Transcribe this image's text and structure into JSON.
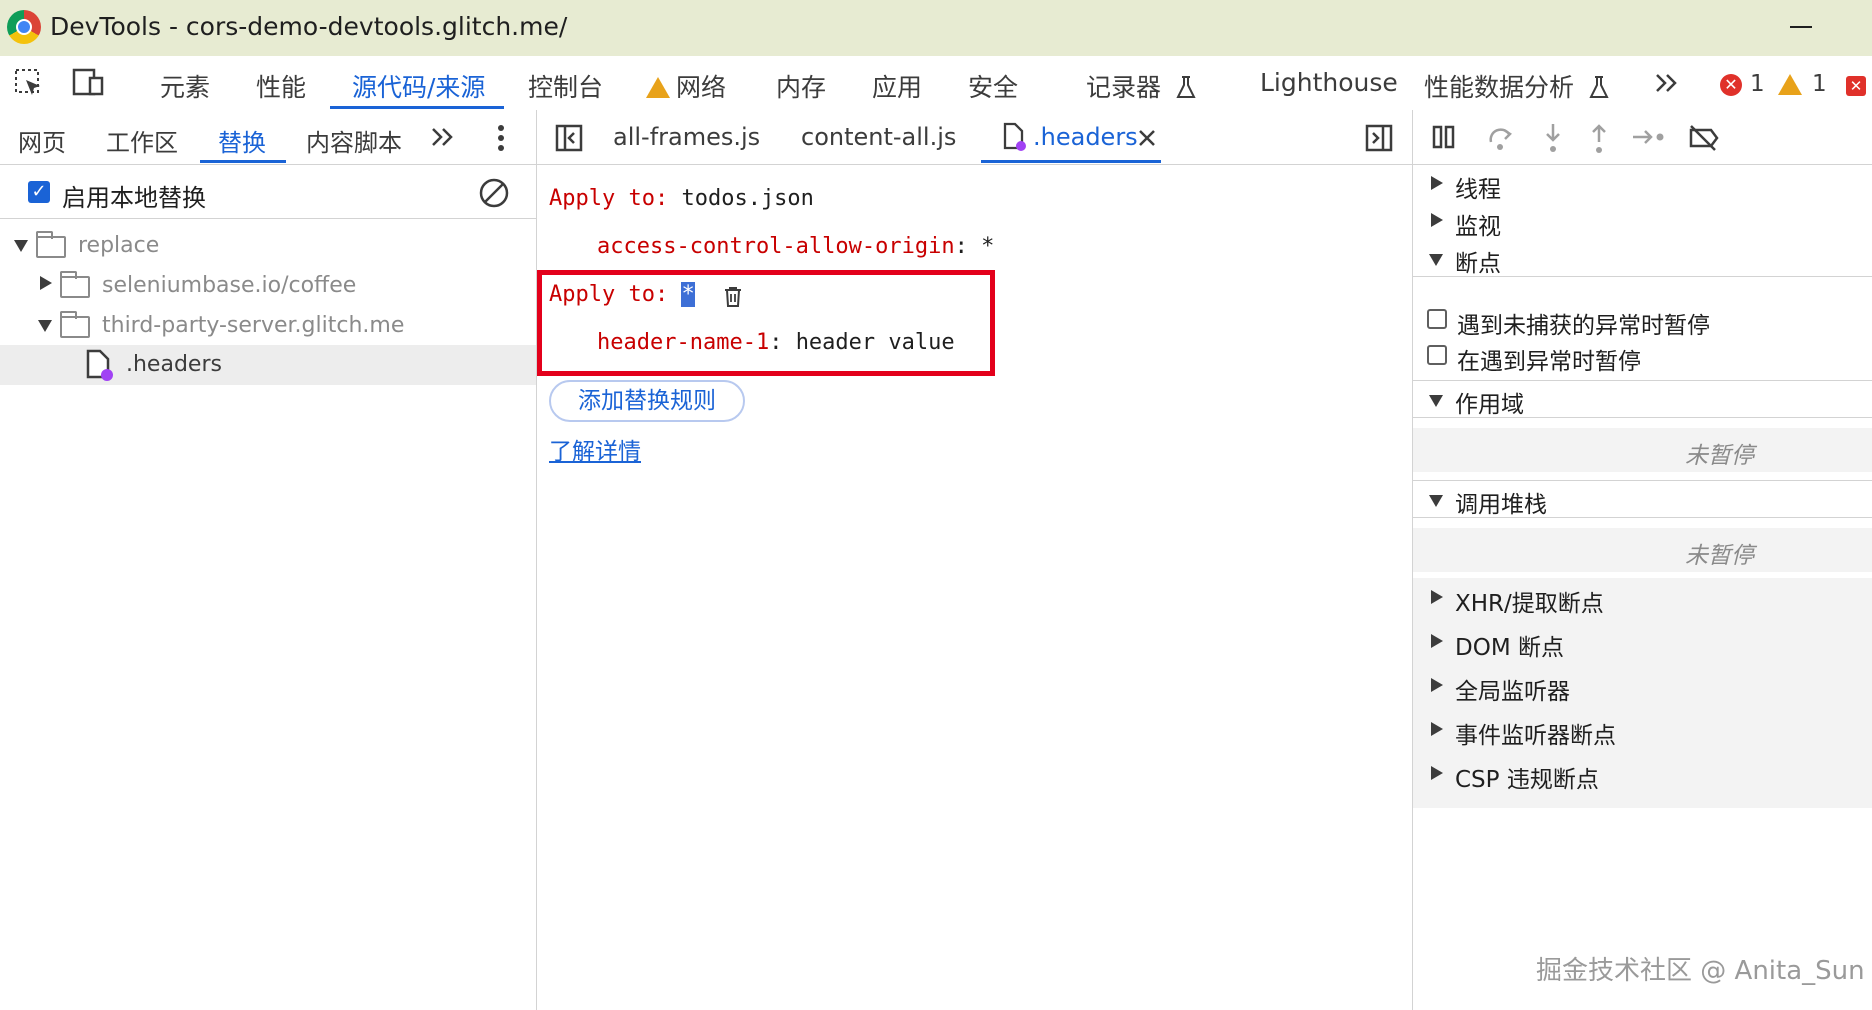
{
  "window": {
    "title": "DevTools - cors-demo-devtools.glitch.me/"
  },
  "main_tabs": [
    {
      "label": "元素"
    },
    {
      "label": "性能"
    },
    {
      "label": "源代码/来源"
    },
    {
      "label": "控制台"
    },
    {
      "label": "网络"
    },
    {
      "label": "内存"
    },
    {
      "label": "应用"
    },
    {
      "label": "安全"
    },
    {
      "label": "记录器"
    },
    {
      "label": "Lighthouse"
    },
    {
      "label": "性能数据分析"
    }
  ],
  "main_active_tab": "源代码/来源",
  "status": {
    "errors": "1",
    "warnings": "1"
  },
  "left_tabs": [
    {
      "label": "网页"
    },
    {
      "label": "工作区"
    },
    {
      "label": "替换"
    },
    {
      "label": "内容脚本"
    }
  ],
  "left_active_tab": "替换",
  "overrides": {
    "enable_label": "启用本地替换",
    "enabled": true
  },
  "file_tree": [
    {
      "label": "replace"
    },
    {
      "label": "seleniumbase.io/coffee"
    },
    {
      "label": "third-party-server.glitch.me"
    },
    {
      "label": ".headers"
    }
  ],
  "editor_tabs": [
    {
      "label": "all-frames.js"
    },
    {
      "label": "content-all.js"
    },
    {
      "label": ".headers"
    }
  ],
  "editor": {
    "rule1": {
      "apply_kw": "Apply to",
      "apply_val": "todos.json",
      "header_name": "access-control-allow-origin",
      "header_value": "*"
    },
    "rule2": {
      "apply_kw": "Apply to",
      "apply_val": "*",
      "header_name": "header-name-1",
      "header_value": "header value"
    },
    "add_rule_button": "添加替换规则",
    "learn_more_link": "了解详情",
    "highlight_color": "#e3001b"
  },
  "debugger_sections": [
    {
      "label": "线程"
    },
    {
      "label": "监视"
    },
    {
      "label": "断点"
    },
    {
      "label": "作用域"
    },
    {
      "label": "调用堆栈"
    },
    {
      "label": "XHR/提取断点"
    },
    {
      "label": "DOM 断点"
    },
    {
      "label": "全局监听器"
    },
    {
      "label": "事件监听器断点"
    },
    {
      "label": "CSP 违规断点"
    }
  ],
  "breakpoint_options": [
    {
      "label": "遇到未捕获的异常时暂停"
    },
    {
      "label": "在遇到异常时暂停"
    }
  ],
  "not_paused_scope": "未暂停",
  "not_paused_callstack": "未暂停",
  "watermark": "掘金技术社区 @ Anita_Sun",
  "colors": {
    "accent": "#1a63d6",
    "keyword": "#c80000",
    "error": "#e0312a",
    "warning": "#e8a21a"
  }
}
